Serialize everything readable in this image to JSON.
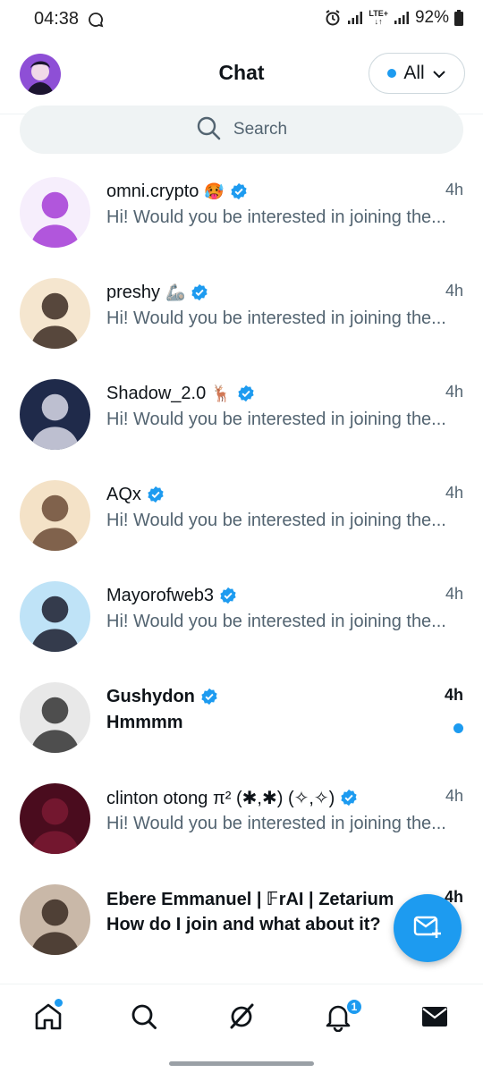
{
  "status_bar": {
    "time": "04:38",
    "lte_top": "LTE+",
    "lte_bottom": "↓↑",
    "battery": "92%"
  },
  "header": {
    "title": "Chat",
    "filter_label": "All",
    "filter_dot_color": "#1d9bf0"
  },
  "search": {
    "label": "Search"
  },
  "chats": [
    {
      "name": "omni.crypto",
      "emoji": "🥵",
      "verified": true,
      "time": "4h",
      "preview": "Hi! Would you be interested in joining the...",
      "unread": false,
      "avatar_colors": [
        "#f6eefc",
        "#a53bd6"
      ]
    },
    {
      "name": "preshy",
      "emoji": "🦾",
      "verified": true,
      "time": "4h",
      "preview": "Hi! Would you be interested in joining the...",
      "unread": false,
      "avatar_colors": [
        "#f5e6cf",
        "#3b2a22"
      ]
    },
    {
      "name": "Shadow_2.0",
      "emoji": "🦌",
      "verified": true,
      "time": "4h",
      "preview": "Hi! Would you be interested in joining the...",
      "unread": false,
      "avatar_colors": [
        "#1f2a4a",
        "#d9d9e8"
      ]
    },
    {
      "name": "AQx",
      "emoji": "",
      "verified": true,
      "time": "4h",
      "preview": "Hi! Would you be interested in joining the...",
      "unread": false,
      "avatar_colors": [
        "#f4e2c7",
        "#6b4b36"
      ]
    },
    {
      "name": "Mayorofweb3",
      "emoji": "",
      "verified": true,
      "time": "4h",
      "preview": "Hi! Would you be interested in joining the...",
      "unread": false,
      "avatar_colors": [
        "#bfe3f7",
        "#1b1d2e"
      ]
    },
    {
      "name": "Gushydon",
      "emoji": "",
      "verified": true,
      "time": "4h",
      "preview": "Hmmmm",
      "unread": true,
      "avatar_colors": [
        "#e8e8e8",
        "#333333"
      ]
    },
    {
      "name": "clinton otong π² (✱,✱) (✧,✧)",
      "emoji": "",
      "verified": true,
      "time": "4h",
      "preview": "Hi! Would you be interested in joining the...",
      "unread": false,
      "avatar_colors": [
        "#4a0c1e",
        "#7a1a33"
      ]
    },
    {
      "name": "Ebere Emmanuel | 𝔽rAI | Zetarium",
      "emoji": "",
      "verified": false,
      "time": "4h",
      "preview": "How do I join and what about it?",
      "unread": true,
      "avatar_colors": [
        "#c9b8a8",
        "#3a2a22"
      ]
    }
  ],
  "fab": {
    "icon": "compose-message-icon"
  },
  "bottom_nav": {
    "items": [
      "home-icon",
      "search-icon",
      "grok-icon",
      "bell-icon",
      "mail-icon"
    ],
    "notification_count": "1"
  },
  "colors": {
    "accent": "#1d9bf0",
    "text_primary": "#0f1419",
    "text_secondary": "#536471"
  }
}
